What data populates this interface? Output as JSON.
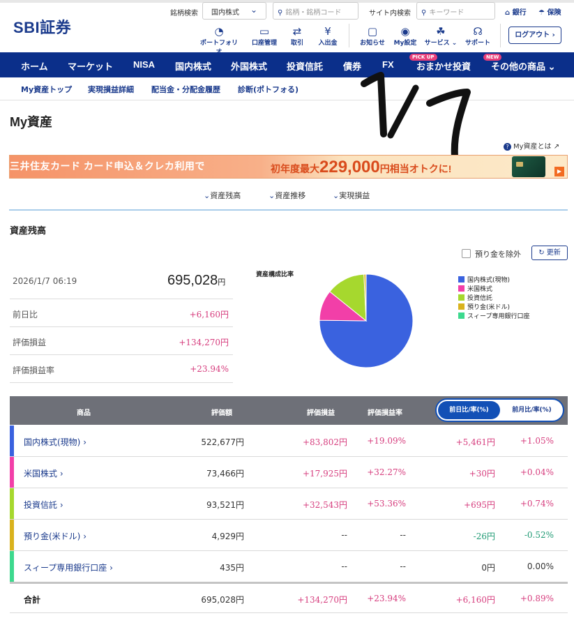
{
  "header": {
    "logo": "SBI証券",
    "stock_search_label": "銘柄検索",
    "market_select": "国内株式",
    "stock_search_placeholder": "銘柄・銘柄コード",
    "site_search_label": "サイト内検索",
    "site_search_placeholder": "キーワード",
    "bank_link": "銀行",
    "insurance_link": "保険",
    "icons": [
      {
        "label": "ポートフォリオ",
        "icon": "pie-icon"
      },
      {
        "label": "口座管理",
        "icon": "card-icon"
      },
      {
        "label": "取引",
        "icon": "exchange-icon"
      },
      {
        "label": "入出金",
        "icon": "yen-icon"
      },
      {
        "label": "お知らせ",
        "icon": "chat-icon"
      },
      {
        "label": "My設定",
        "icon": "user-icon"
      },
      {
        "label": "サービス",
        "icon": "hand-icon"
      },
      {
        "label": "サポート",
        "icon": "headset-icon"
      }
    ],
    "logout": "ログアウト"
  },
  "main_nav": {
    "items": [
      "ホーム",
      "マーケット",
      "NISA",
      "国内株式",
      "外国株式",
      "投資信託",
      "債券",
      "FX",
      "おまかせ投資",
      "その他の商品"
    ],
    "pickup_badge": "PICK UP",
    "new_badge": "NEW"
  },
  "sub_nav": [
    "My資産トップ",
    "実現損益詳細",
    "配当金・分配金履歴",
    "診断(ポトフォる)"
  ],
  "page_title": "My資産",
  "handwritten_note": "1/7",
  "help_link": "My資産とは",
  "banner": {
    "left_text": "三井住友カード カード申込＆クレカ利用で",
    "right_prefix": "初年度最大",
    "right_amount": "229,000",
    "right_suffix": "円相当オトクに!"
  },
  "anchors": [
    "資産残高",
    "資産推移",
    "実現損益"
  ],
  "section_title": "資産残高",
  "exclude_deposit_label": "預り金を除外",
  "refresh_button": "更新",
  "summary": {
    "datetime": "2026/1/7 06:19",
    "total_value": "695,028",
    "yen_unit": "円",
    "rows": [
      {
        "label": "前日比",
        "value": "+6,160円"
      },
      {
        "label": "評価損益",
        "value": "+134,270円"
      },
      {
        "label": "評価損益率",
        "value": "+23.94%"
      }
    ]
  },
  "chart_data": {
    "type": "pie",
    "title": "資産構成比率",
    "categories": [
      "国内株式(現物)",
      "米国株式",
      "投資信託",
      "預り金(米ドル)",
      "スィープ専用銀行口座"
    ],
    "values": [
      522677,
      73466,
      93521,
      4929,
      435
    ],
    "colors": [
      "#3a62df",
      "#f23fa8",
      "#a6d82e",
      "#d9b21d",
      "#3dd98e"
    ],
    "legend": "right"
  },
  "table": {
    "headers": [
      "商品",
      "評価額",
      "評価損益",
      "評価損益率"
    ],
    "toggle_active": "前日比/率(%)",
    "toggle_inactive": "前月比/率(%)",
    "rows": [
      {
        "name": "国内株式(現物)",
        "value": "522,677円",
        "pl": "+83,802円",
        "pl_rate": "+19.09%",
        "day_change": "+5,461円",
        "day_rate": "+1.05%"
      },
      {
        "name": "米国株式",
        "value": "73,466円",
        "pl": "+17,925円",
        "pl_rate": "+32.27%",
        "day_change": "+30円",
        "day_rate": "+0.04%"
      },
      {
        "name": "投資信託",
        "value": "93,521円",
        "pl": "+32,543円",
        "pl_rate": "+53.36%",
        "day_change": "+695円",
        "day_rate": "+0.74%"
      },
      {
        "name": "預り金(米ドル)",
        "value": "4,929円",
        "pl": "--",
        "pl_rate": "--",
        "day_change": "-26円",
        "day_rate": "-0.52%"
      },
      {
        "name": "スィープ専用銀行口座",
        "value": "435円",
        "pl": "--",
        "pl_rate": "--",
        "day_change": "0円",
        "day_rate": "0.00%"
      }
    ],
    "total": {
      "label": "合計",
      "value": "695,028円",
      "pl": "+134,270円",
      "pl_rate": "+23.94%",
      "day_change": "+6,160円",
      "day_rate": "+0.89%"
    }
  },
  "colors": {
    "brand_navy": "#0b2f8a",
    "positive": "#d63c7d",
    "negative": "#1f9a74",
    "accent_blue": "#1250b6"
  }
}
